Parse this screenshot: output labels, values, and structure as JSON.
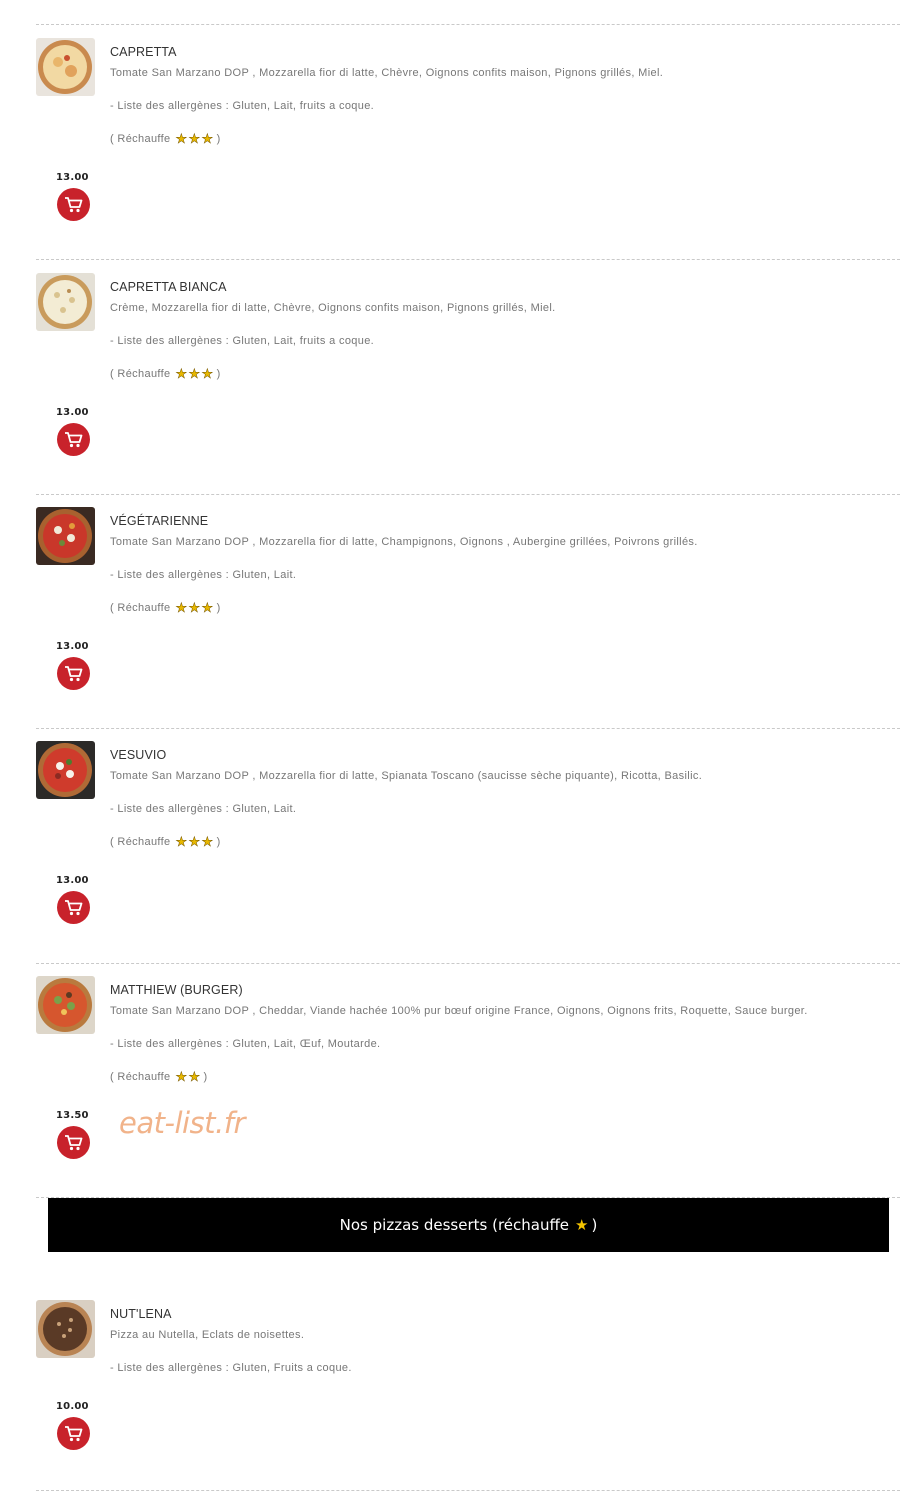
{
  "heat_label": "( Réchauffe",
  "heat_close": ")",
  "items": [
    {
      "name": "CAPRETTA",
      "description": "Tomate San Marzano DOP , Mozzarella fior di latte, Chèvre, Oignons confits maison, Pignons grillés, Miel.",
      "allergens": "- Liste des allergènes : Gluten, Lait, fruits a coque.",
      "heat_stars": 3,
      "price": "13.00",
      "image_icon": "pizza-margherita-icon"
    },
    {
      "name": "CAPRETTA BIANCA",
      "description": "Crème, Mozzarella fior di latte, Chèvre, Oignons confits maison, Pignons grillés, Miel.",
      "allergens": "- Liste des allergènes : Gluten, Lait, fruits a coque.",
      "heat_stars": 3,
      "price": "13.00",
      "image_icon": "pizza-bianca-icon"
    },
    {
      "name": "VÉGÉTARIENNE",
      "description": "Tomate San Marzano DOP , Mozzarella fior di latte, Champignons, Oignons , Aubergine grillées, Poivrons grillés.",
      "allergens": "- Liste des allergènes : Gluten, Lait.",
      "heat_stars": 3,
      "price": "13.00",
      "image_icon": "pizza-vegetarian-icon"
    },
    {
      "name": "VESUVIO",
      "description": "Tomate San Marzano DOP , Mozzarella fior di latte, Spianata Toscano (saucisse sèche piquante), Ricotta, Basilic.",
      "allergens": "- Liste des allergènes : Gluten, Lait.",
      "heat_stars": 3,
      "price": "13.00",
      "image_icon": "pizza-vesuvio-icon"
    },
    {
      "name": "MATTHIEW (BURGER)",
      "description": "Tomate San Marzano DOP , Cheddar, Viande hachée 100% pur bœuf origine France, Oignons, Oignons frits, Roquette, Sauce burger.",
      "allergens": "- Liste des allergènes : Gluten, Lait, Œuf, Moutarde.",
      "heat_stars": 2,
      "price": "13.50",
      "image_icon": "pizza-burger-icon"
    }
  ],
  "section": {
    "title": "Nos pizzas desserts (réchauffe",
    "close": ")"
  },
  "dessert_items": [
    {
      "name": "NUT'LENA",
      "description": "Pizza au Nutella, Eclats de noisettes.",
      "allergens": "- Liste des allergènes : Gluten, Fruits a coque.",
      "price": "10.00",
      "image_icon": "pizza-nutella-icon"
    }
  ],
  "watermark": "eat-list.fr",
  "colors": {
    "cart_button": "#c8222b",
    "star": "#e8b800",
    "banner_bg": "#000000",
    "watermark": "#f1b38a"
  }
}
